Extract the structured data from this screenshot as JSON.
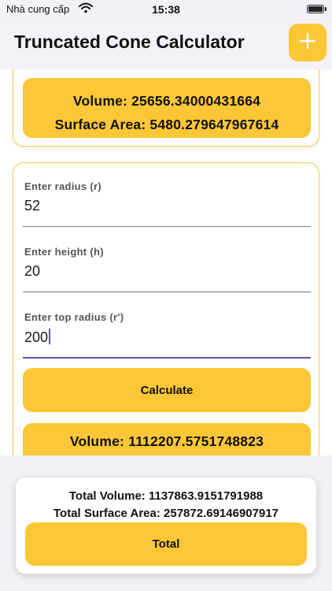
{
  "status": {
    "carrier": "Nhà cung cấp",
    "time": "15:38",
    "wifi_icon": "wifi-icon",
    "battery_icon": "battery-icon"
  },
  "appbar": {
    "title": "Truncated Cone Calculator",
    "add_icon": "plus-icon"
  },
  "previous_card": {
    "volume": "Volume: 25656.34000431664",
    "surface_area": "Surface Area: 5480.279647967614"
  },
  "form": {
    "radius": {
      "label": "Enter radius (r)",
      "value": "52"
    },
    "height": {
      "label": "Enter height (h)",
      "value": "20"
    },
    "top_radius": {
      "label": "Enter top radius (r')",
      "value": "200"
    },
    "calculate_label": "Calculate",
    "result_volume": "Volume: 1112207.5751748823"
  },
  "summary": {
    "total_volume": "Total Volume: 1137863.9151791988",
    "total_surface_area": "Total Surface Area: 257872.69146907917",
    "total_label": "Total"
  },
  "colors": {
    "accent": "#fcc736",
    "focus": "#6650a4",
    "background": "#f2f1f6"
  }
}
